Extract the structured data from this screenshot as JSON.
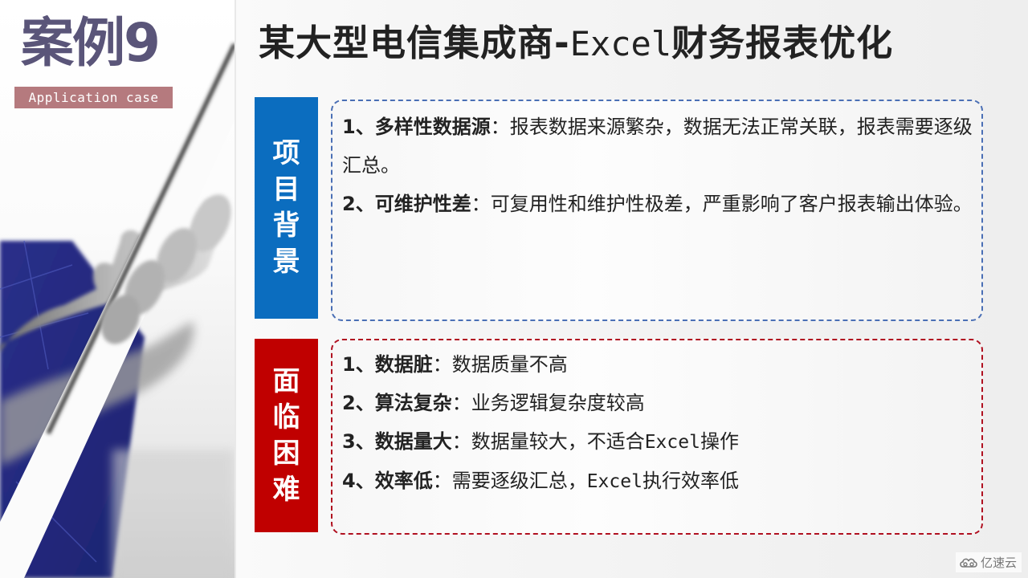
{
  "header": {
    "case_title": "案例9",
    "case_subtitle": "Application case",
    "page_title_prefix": "某大型电信集成商-",
    "page_title_mono": "Excel",
    "page_title_suffix": "财务报表优化"
  },
  "sections": {
    "background": {
      "label_chars": [
        "项",
        "目",
        "背",
        "景"
      ],
      "color": "#0b6dbf",
      "border_color": "#4a6fb5",
      "items": [
        {
          "number": "1、",
          "title": "多样性数据源",
          "text": "：报表数据来源繁杂，数据无法正常关联，报表需要逐级汇总。"
        },
        {
          "number": "2、",
          "title": "可维护性差",
          "text": "：可复用性和维护性极差，严重影响了客户报表输出体验。"
        }
      ]
    },
    "challenges": {
      "label_chars": [
        "面",
        "临",
        "困",
        "难"
      ],
      "color": "#c00000",
      "border_color": "#b01020",
      "items": [
        {
          "number": "1、",
          "title": "数据脏",
          "text_before": "：数据质量不高",
          "mono": "",
          "text_after": ""
        },
        {
          "number": "2、",
          "title": "算法复杂",
          "text_before": "：业务逻辑复杂度较高",
          "mono": "",
          "text_after": ""
        },
        {
          "number": "3、",
          "title": "数据量大",
          "text_before": "：数据量较大，不适合",
          "mono": "Excel",
          "text_after": "操作"
        },
        {
          "number": "4、",
          "title": "效率低",
          "text_before": "：需要逐级汇总，",
          "mono": "Excel",
          "text_after": "执行效率低"
        }
      ]
    }
  },
  "watermark": {
    "icon": "cloud-logo-icon",
    "text": "亿速云"
  },
  "colors": {
    "case_title": "#5a5579",
    "case_subtitle_bg": "#b57a7e"
  }
}
